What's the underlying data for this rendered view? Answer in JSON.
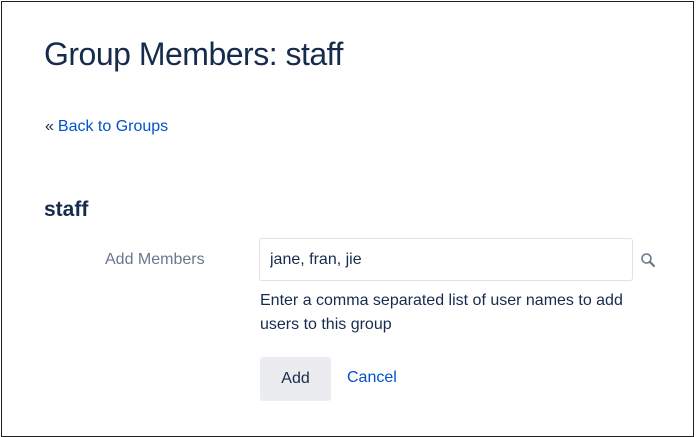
{
  "page": {
    "title": "Group Members: staff"
  },
  "nav": {
    "back_prefix": "«",
    "back_label": "Back to Groups"
  },
  "group": {
    "name": "staff"
  },
  "form": {
    "add_members_label": "Add Members",
    "members_value": "jane, fran, jie",
    "help_text": "Enter a comma separated list of user names to add users to this group",
    "add_label": "Add",
    "cancel_label": "Cancel"
  },
  "icons": {
    "user_picker": "search-icon"
  },
  "colors": {
    "text": "#172b4d",
    "link": "#0052cc",
    "label": "#6b778c",
    "button_bg": "#ebecf0",
    "input_border": "#dfe1e6"
  }
}
